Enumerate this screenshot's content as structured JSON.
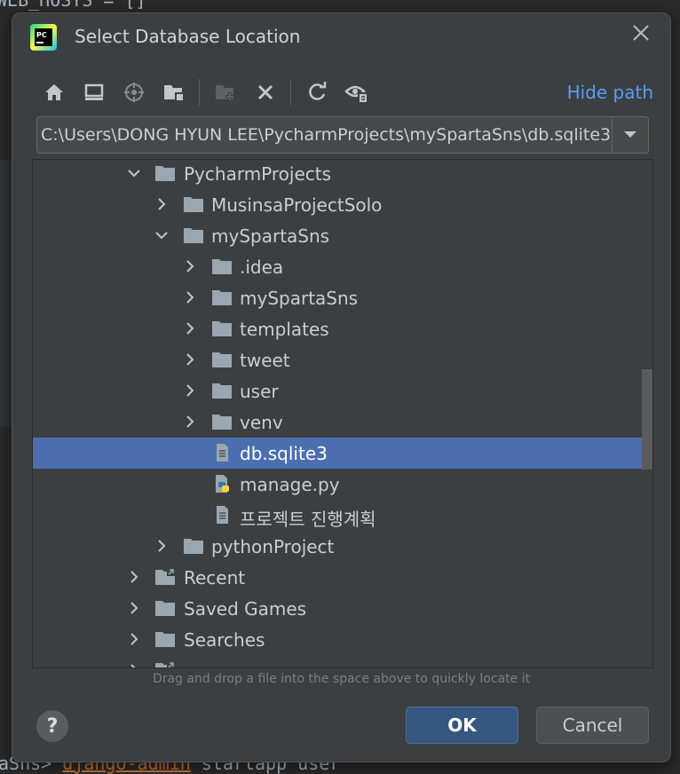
{
  "background": {
    "top_code": "WEB_HOSTS = []",
    "bottom_prompt": "aSns> ",
    "bottom_command": "django-admin",
    "bottom_rest": " startapp user"
  },
  "dialog": {
    "title": "Select Database Location",
    "app_icon_text": "PC",
    "hide_path_label": "Hide path",
    "path_value": "C:\\Users\\DONG HYUN LEE\\PycharmProjects\\mySpartaSns\\db.sqlite3",
    "toolbar": [
      {
        "name": "home-icon",
        "enabled": true
      },
      {
        "name": "desktop-icon",
        "enabled": true
      },
      {
        "name": "project-icon",
        "enabled": true
      },
      {
        "name": "module-icon",
        "enabled": true
      },
      {
        "name": "new-folder-icon",
        "enabled": false
      },
      {
        "name": "delete-icon",
        "enabled": true
      },
      {
        "name": "refresh-icon",
        "enabled": true
      },
      {
        "name": "show-hidden-icon",
        "enabled": true
      }
    ],
    "tree": [
      {
        "label": "PycharmProjects",
        "level": 0,
        "arrow": "down",
        "type": "folder"
      },
      {
        "label": "MusinsaProjectSolo",
        "level": 1,
        "arrow": "right",
        "type": "folder"
      },
      {
        "label": "mySpartaSns",
        "level": 1,
        "arrow": "down",
        "type": "folder"
      },
      {
        "label": ".idea",
        "level": 2,
        "arrow": "right",
        "type": "folder"
      },
      {
        "label": "mySpartaSns",
        "level": 2,
        "arrow": "right",
        "type": "folder"
      },
      {
        "label": "templates",
        "level": 2,
        "arrow": "right",
        "type": "folder"
      },
      {
        "label": "tweet",
        "level": 2,
        "arrow": "right",
        "type": "folder"
      },
      {
        "label": "user",
        "level": 2,
        "arrow": "right",
        "type": "folder"
      },
      {
        "label": "venv",
        "level": 2,
        "arrow": "right",
        "type": "folder"
      },
      {
        "label": "db.sqlite3",
        "level": 2,
        "arrow": "none",
        "type": "file",
        "selected": true
      },
      {
        "label": "manage.py",
        "level": 2,
        "arrow": "none",
        "type": "python"
      },
      {
        "label": "프로젝트 진행계획",
        "level": 2,
        "arrow": "none",
        "type": "file"
      },
      {
        "label": "pythonProject",
        "level": 1,
        "arrow": "right",
        "type": "folder"
      },
      {
        "label": "Recent",
        "level": 0,
        "arrow": "right",
        "type": "link-folder"
      },
      {
        "label": "Saved Games",
        "level": 0,
        "arrow": "right",
        "type": "folder"
      },
      {
        "label": "Searches",
        "level": 0,
        "arrow": "right",
        "type": "folder"
      },
      {
        "label": "",
        "level": 0,
        "arrow": "right",
        "type": "link-folder"
      }
    ],
    "hint": "Drag and drop a file into the space above to quickly locate it",
    "help_label": "?",
    "ok_label": "OK",
    "cancel_label": "Cancel",
    "colors": {
      "selection": "#4b6eaf",
      "link": "#589df6",
      "ok_button": "#365880"
    }
  }
}
